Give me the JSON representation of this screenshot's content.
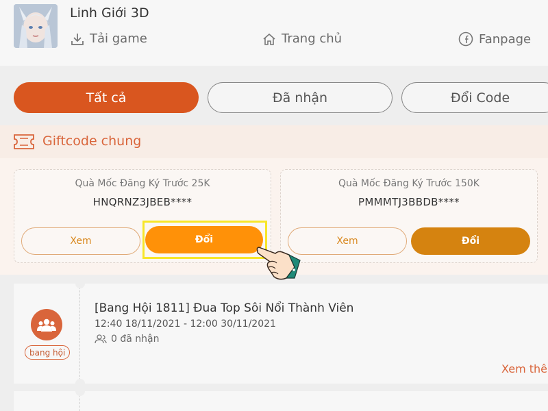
{
  "header": {
    "game_title": "Linh Giới 3D",
    "nav": {
      "download": "Tải game",
      "home": "Trang chủ",
      "fanpage": "Fanpage"
    }
  },
  "tabs": [
    "Tất cả",
    "Đã nhận",
    "Đổi Code"
  ],
  "section": {
    "title": "Giftcode chung"
  },
  "giftcodes": [
    {
      "title": "Quà Mốc Đăng Ký Trước 25K",
      "code": "HNQRNZ3JBEB****",
      "view_label": "Xem",
      "redeem_label": "Đổi"
    },
    {
      "title": "Quà Mốc Đăng Ký Trước 150K",
      "code": "PMMMTJ3BBDB****",
      "view_label": "Xem",
      "redeem_label": "Đổi"
    }
  ],
  "event": {
    "title": "[Bang Hội 1811] Đua Top Sôi Nổi Thành Viên",
    "time": "12:40 18/11/2021 - 12:00 30/11/2021",
    "received": "0 đã nhận",
    "tag": "bang hội",
    "more": "Xem thê"
  },
  "colors": {
    "accent": "#d9561f",
    "redeem": "#ff9108",
    "highlight": "#f7e62a"
  }
}
